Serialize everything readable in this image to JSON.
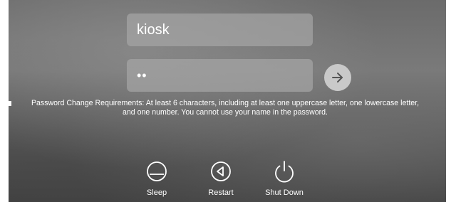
{
  "login": {
    "username_value": "kiosk",
    "password_value": "••",
    "submit_icon": "arrow-right-icon"
  },
  "requirements_text": "Password Change Requirements: At least 6 characters, including at least one uppercase letter, one lowercase letter, and one number.  You cannot use your name in the password.",
  "power_options": {
    "sleep": {
      "label": "Sleep",
      "icon": "sleep-icon"
    },
    "restart": {
      "label": "Restart",
      "icon": "restart-icon"
    },
    "shutdown": {
      "label": "Shut Down",
      "icon": "power-icon"
    }
  }
}
